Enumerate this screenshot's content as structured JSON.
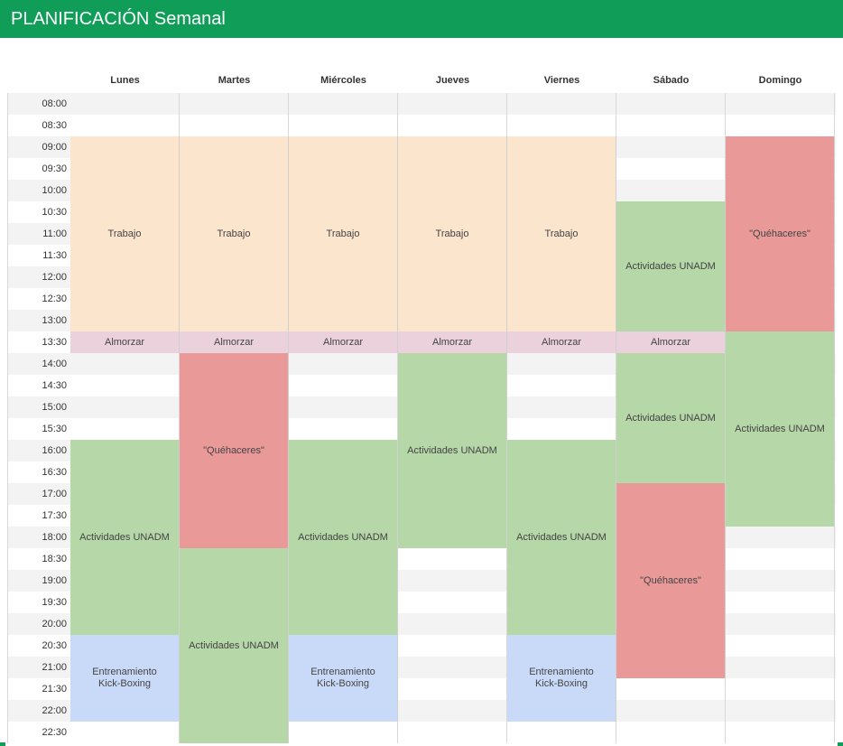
{
  "title": "PLANIFICACIÓN Semanal",
  "days": [
    "Lunes",
    "Martes",
    "Miércoles",
    "Jueves",
    "Viernes",
    "Sábado",
    "Domingo"
  ],
  "times": [
    "08:00",
    "08:30",
    "09:00",
    "09:30",
    "10:00",
    "10:30",
    "11:00",
    "11:30",
    "12:00",
    "12:30",
    "13:00",
    "13:30",
    "14:00",
    "14:30",
    "15:00",
    "15:30",
    "16:00",
    "16:30",
    "17:00",
    "17:30",
    "18:00",
    "18:30",
    "19:00",
    "19:30",
    "20:00",
    "20:30",
    "21:00",
    "21:30",
    "22:00",
    "22:30"
  ],
  "colors": {
    "trabajo": "#fce5cd",
    "almorzar": "#ead1dc",
    "actividades": "#b6d7a8",
    "quehaceres": "#ea9999",
    "entrenamiento": "#c9daf8",
    "header": "#0f9d58"
  },
  "events": [
    {
      "day": 0,
      "start": 2,
      "end": 11,
      "label": "Trabajo",
      "kind": "trabajo"
    },
    {
      "day": 1,
      "start": 2,
      "end": 11,
      "label": "Trabajo",
      "kind": "trabajo"
    },
    {
      "day": 2,
      "start": 2,
      "end": 11,
      "label": "Trabajo",
      "kind": "trabajo"
    },
    {
      "day": 3,
      "start": 2,
      "end": 11,
      "label": "Trabajo",
      "kind": "trabajo"
    },
    {
      "day": 4,
      "start": 2,
      "end": 11,
      "label": "Trabajo",
      "kind": "trabajo"
    },
    {
      "day": 5,
      "start": 5,
      "end": 11,
      "label": "Actividades UNADM",
      "kind": "actividades"
    },
    {
      "day": 6,
      "start": 2,
      "end": 11,
      "label": "\"Quéhaceres\"",
      "kind": "quehaceres"
    },
    {
      "day": 0,
      "start": 11,
      "end": 12,
      "label": "Almorzar",
      "kind": "almorzar"
    },
    {
      "day": 1,
      "start": 11,
      "end": 12,
      "label": "Almorzar",
      "kind": "almorzar"
    },
    {
      "day": 2,
      "start": 11,
      "end": 12,
      "label": "Almorzar",
      "kind": "almorzar"
    },
    {
      "day": 3,
      "start": 11,
      "end": 12,
      "label": "Almorzar",
      "kind": "almorzar"
    },
    {
      "day": 4,
      "start": 11,
      "end": 12,
      "label": "Almorzar",
      "kind": "almorzar"
    },
    {
      "day": 5,
      "start": 11,
      "end": 12,
      "label": "Almorzar",
      "kind": "almorzar"
    },
    {
      "day": 6,
      "start": 11,
      "end": 20,
      "label": "Actividades UNADM",
      "kind": "actividades"
    },
    {
      "day": 0,
      "start": 16,
      "end": 25,
      "label": "Actividades UNADM",
      "kind": "actividades"
    },
    {
      "day": 0,
      "start": 25,
      "end": 29,
      "label": "Entrenamiento\nKick-Boxing",
      "kind": "entrenamiento"
    },
    {
      "day": 1,
      "start": 12,
      "end": 21,
      "label": "\"Quéhaceres\"",
      "kind": "quehaceres"
    },
    {
      "day": 1,
      "start": 21,
      "end": 30,
      "label": "Actividades UNADM",
      "kind": "actividades"
    },
    {
      "day": 2,
      "start": 16,
      "end": 25,
      "label": "Actividades UNADM",
      "kind": "actividades"
    },
    {
      "day": 2,
      "start": 25,
      "end": 29,
      "label": "Entrenamiento\nKick-Boxing",
      "kind": "entrenamiento"
    },
    {
      "day": 3,
      "start": 12,
      "end": 21,
      "label": "Actividades UNADM",
      "kind": "actividades"
    },
    {
      "day": 4,
      "start": 16,
      "end": 25,
      "label": "Actividades UNADM",
      "kind": "actividades"
    },
    {
      "day": 4,
      "start": 25,
      "end": 29,
      "label": "Entrenamiento\nKick-Boxing",
      "kind": "entrenamiento"
    },
    {
      "day": 5,
      "start": 12,
      "end": 18,
      "label": "Actividades UNADM",
      "kind": "actividades"
    },
    {
      "day": 5,
      "start": 18,
      "end": 27,
      "label": "\"Quéhaceres\"",
      "kind": "quehaceres"
    }
  ]
}
